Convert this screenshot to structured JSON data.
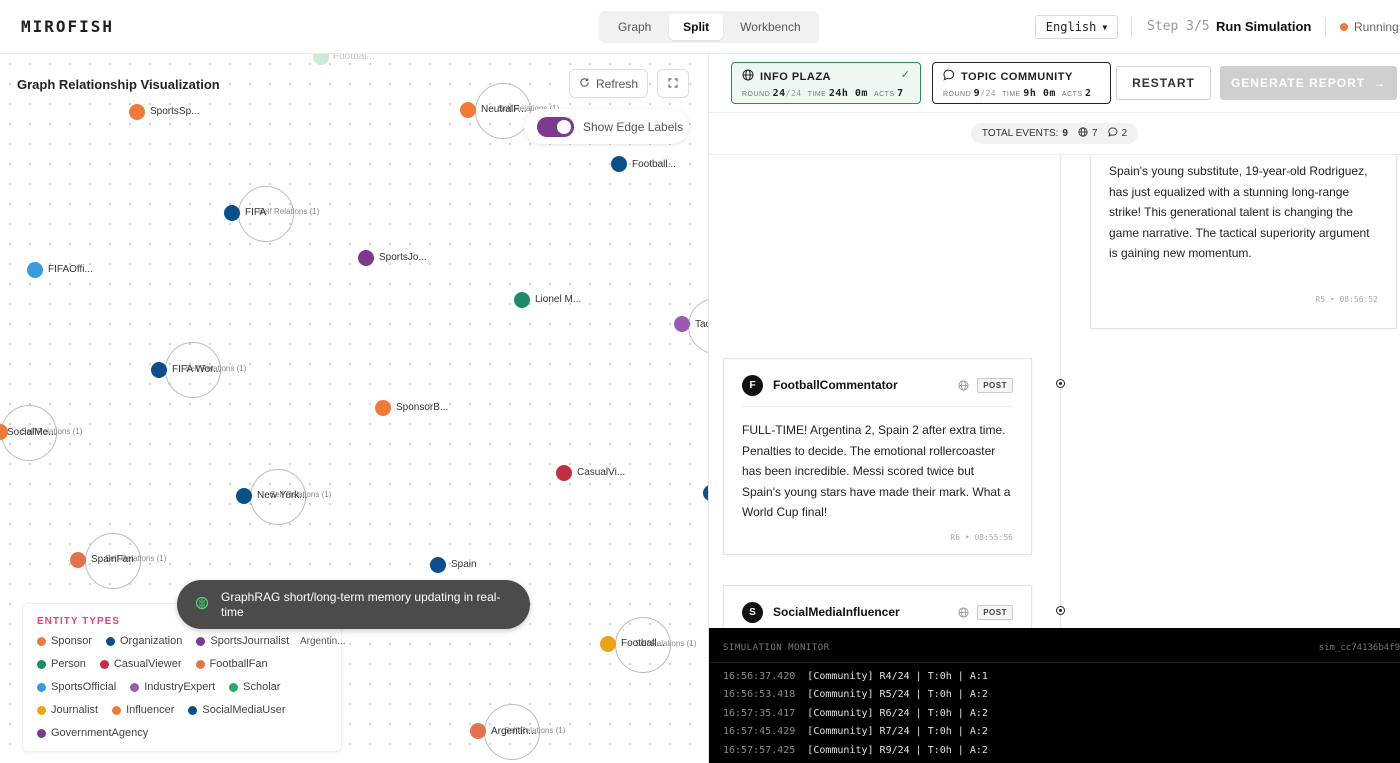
{
  "app": {
    "logo": "MIROFISH",
    "view_tabs": [
      "Graph",
      "Split",
      "Workbench"
    ],
    "active_view": "Split",
    "language": "English",
    "step_label": "Step 3/5",
    "step_title": "Run Simulation",
    "status": "Running",
    "status_color": "#f07a3a"
  },
  "graph": {
    "title": "Graph Relationship Visualization",
    "refresh_label": "Refresh",
    "edge_toggle_label": "Show Edge Labels",
    "edge_labels_on": true,
    "nodes": [
      {
        "label": "Footbal...",
        "color": "#2eaa6b"
      },
      {
        "label": "SportsSp...",
        "color": "#f07a3a"
      },
      {
        "label": "NeutralF...",
        "color": "#f07a3a"
      },
      {
        "label": "Football...",
        "color": "#0b4f8a"
      },
      {
        "label": "FIFA",
        "color": "#0b4f8a"
      },
      {
        "label": "FIFAOffi...",
        "color": "#3b9ad9"
      },
      {
        "label": "SportsJo...",
        "color": "#7a3b8f"
      },
      {
        "label": "Lionel M...",
        "color": "#1f8a6a"
      },
      {
        "label": "Tac",
        "color": "#9b59b6"
      },
      {
        "label": "FIFA Wor...",
        "color": "#0b4f8a"
      },
      {
        "label": "SponsorB...",
        "color": "#f07a3a"
      },
      {
        "label": "SocialMe...",
        "color": "#f07a3a"
      },
      {
        "label": "CasualVi...",
        "color": "#c0303f"
      },
      {
        "label": "New York...",
        "color": "#0b4f8a"
      },
      {
        "label": "SpainFan",
        "color": "#e2734f"
      },
      {
        "label": "Spain",
        "color": "#0b4f8a"
      },
      {
        "label": "Football...",
        "color": "#e8a317"
      },
      {
        "label": "Argentin...",
        "color": "#e2734f"
      },
      {
        "label": "",
        "color": "#0b4f8a"
      }
    ],
    "self_relations": [
      "Self Relations (1)",
      "Self Relations (1)",
      "Self Relations (1)",
      "Self Relations (1)",
      "Self Relations (1)",
      "Self Relations (1)",
      "Self Relations (1)",
      "Self Relations (1)"
    ],
    "hidden_label": "Argentin...",
    "memory_toast": "GraphRAG short/long-term memory updating in real-time"
  },
  "legend": {
    "title": "ENTITY TYPES",
    "items": [
      {
        "label": "Sponsor",
        "color": "#f07a3a"
      },
      {
        "label": "Organization",
        "color": "#0b4f8a"
      },
      {
        "label": "SportsJournalist",
        "color": "#7a3b8f"
      },
      {
        "label": "Person",
        "color": "#1f8a6a"
      },
      {
        "label": "CasualViewer",
        "color": "#c0303f"
      },
      {
        "label": "FootballFan",
        "color": "#e2734f"
      },
      {
        "label": "SportsOfficial",
        "color": "#3b9ad9"
      },
      {
        "label": "IndustryExpert",
        "color": "#9b59b6"
      },
      {
        "label": "Scholar",
        "color": "#27ae60"
      },
      {
        "label": "Journalist",
        "color": "#e8a317"
      },
      {
        "label": "Influencer",
        "color": "#f07a3a"
      },
      {
        "label": "SocialMediaUser",
        "color": "#0b4f8a"
      },
      {
        "label": "GovernmentAgency",
        "color": "#7a3b8f"
      }
    ]
  },
  "simulation": {
    "platforms": [
      {
        "name": "INFO PLAZA",
        "round": "24",
        "round_total": "/24",
        "time": "24h 0m",
        "acts": "7",
        "done": true
      },
      {
        "name": "TOPIC COMMUNITY",
        "round": "9",
        "round_total": "/24",
        "time": "9h 0m",
        "acts": "2",
        "done": false
      }
    ],
    "stat_labels": {
      "round": "ROUND",
      "time": "TIME",
      "acts": "ACTS"
    },
    "restart_label": "RESTART",
    "report_label": "GENERATE REPORT",
    "events": {
      "label": "TOTAL EVENTS:",
      "total": "9",
      "plaza": "7",
      "community": "2"
    },
    "posts": [
      {
        "author": "",
        "avatar": "",
        "badge": "",
        "body": "Spain's young substitute, 19-year-old Rodriguez, has just equalized with a stunning long-range strike! This generational talent is changing the game narrative. The tactical superiority argument is gaining new momentum.",
        "meta": "R5 • 08:56:52"
      },
      {
        "author": "FootballCommentator",
        "avatar": "F",
        "badge": "POST",
        "body": "FULL-TIME! Argentina 2, Spain 2 after extra time. Penalties to decide. The emotional rollercoaster has been incredible. Messi scored twice but Spain's young stars have made their mark. What a World Cup final!",
        "meta": "R6 • 08:55:56"
      },
      {
        "author": "SocialMediaInfluencer",
        "avatar": "S",
        "badge": "POST",
        "body": "",
        "meta": ""
      }
    ]
  },
  "monitor": {
    "title": "SIMULATION MONITOR",
    "sim_id": "sim_cc74136b4f9",
    "logs": [
      {
        "time": "16:56:37.420",
        "msg": "[Community] R4/24 | T:0h | A:1"
      },
      {
        "time": "16:56:53.418",
        "msg": "[Community] R5/24 | T:0h | A:2"
      },
      {
        "time": "16:57:35.417",
        "msg": "[Community] R6/24 | T:0h | A:2"
      },
      {
        "time": "16:57:45.429",
        "msg": "[Community] R7/24 | T:0h | A:2"
      },
      {
        "time": "16:57:57.425",
        "msg": "[Community] R9/24 | T:0h | A:2"
      }
    ]
  }
}
